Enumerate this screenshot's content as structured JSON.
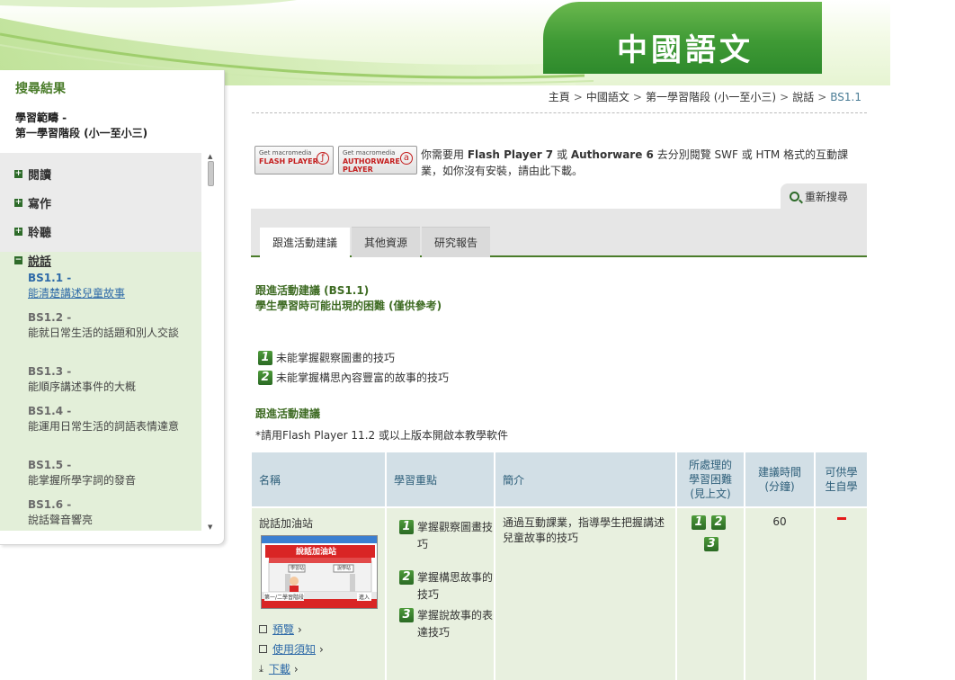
{
  "banner": {
    "title": "中國語文"
  },
  "sidebar": {
    "heading": "搜尋結果",
    "scope_label": "學習範疇 -",
    "scope_value": "第一學習階段 (小一至小三)",
    "top_items": [
      {
        "label": "閱讀"
      },
      {
        "label": "寫作"
      },
      {
        "label": "聆聽"
      },
      {
        "label": "說話"
      }
    ],
    "sub_items": [
      {
        "code": "BS1.1 -",
        "desc": "能清楚講述兒童故事"
      },
      {
        "code": "BS1.2 -",
        "desc": "能就日常生活的話題和別人交談"
      },
      {
        "code": "BS1.3 -",
        "desc": "能順序講述事件的大概"
      },
      {
        "code": "BS1.4 -",
        "desc": "能運用日常生活的詞語表情達意"
      },
      {
        "code": "BS1.5 -",
        "desc": "能掌握所學字詞的發音"
      },
      {
        "code": "BS1.6 -",
        "desc": "說話聲音響亮"
      }
    ]
  },
  "breadcrumb": {
    "items": [
      "主頁",
      "中國語文",
      "第一學習階段 (小一至小三)",
      "說話"
    ],
    "current": "BS1.1"
  },
  "plugins": {
    "flash": {
      "small": "Get macromedia",
      "big": "FLASH PLAYER"
    },
    "authorware": {
      "small": "Get macromedia",
      "big": "AUTHORWARE PLAYER"
    },
    "note_prefix": "你需要用",
    "note_flash": "Flash Player 7",
    "note_or": "或",
    "note_authorware": "Authorware 6",
    "note_suffix": "去分別閱覽 SWF 或 HTM 格式的互動課業，如你沒有安裝，請由此下載。"
  },
  "research_button": "重新搜尋",
  "tabs": [
    {
      "label": "跟進活動建議"
    },
    {
      "label": "其他資源"
    },
    {
      "label": "研究報告"
    }
  ],
  "content": {
    "follow_title": "跟進活動建議 (BS1.1)",
    "follow_sub": "學生學習時可能出現的困難 (僅供參考)",
    "difficulties": [
      {
        "num": "1",
        "text": "未能掌握觀察圖畫的技巧"
      },
      {
        "num": "2",
        "text": "未能掌握構思內容豐富的故事的技巧"
      }
    ],
    "activities_title": "跟進活動建議",
    "flash_note": "*請用Flash Player 11.2 或以上版本開啟本教學軟件"
  },
  "table": {
    "headers": {
      "name": "名稱",
      "focus": "學習重點",
      "intro": "簡介",
      "difficulty": [
        "所處理的",
        "學習困難",
        "(見上文)"
      ],
      "time": [
        "建議時間",
        "(分鐘)"
      ],
      "self": [
        "可供學",
        "生自學"
      ]
    },
    "row": {
      "name": "說話加油站",
      "thumbnail": {
        "banner": "說話加油站",
        "sign_left": "學習站",
        "sign_right": "說學站",
        "level": "第一/二學習階段",
        "enter": "進入"
      },
      "links": [
        "預覽",
        "使用須知",
        "下載"
      ],
      "focus": [
        {
          "num": "1",
          "text": "掌握觀察圖畫技巧"
        },
        {
          "num": "2",
          "text": "掌握構思故事的技巧"
        },
        {
          "num": "3",
          "text": "掌握說故事的表達技巧"
        }
      ],
      "intro": "通過互動課業，指導學生把握講述兒童故事的技巧",
      "difficulty_nums": [
        "1",
        "2",
        "3"
      ],
      "time": "60"
    }
  }
}
